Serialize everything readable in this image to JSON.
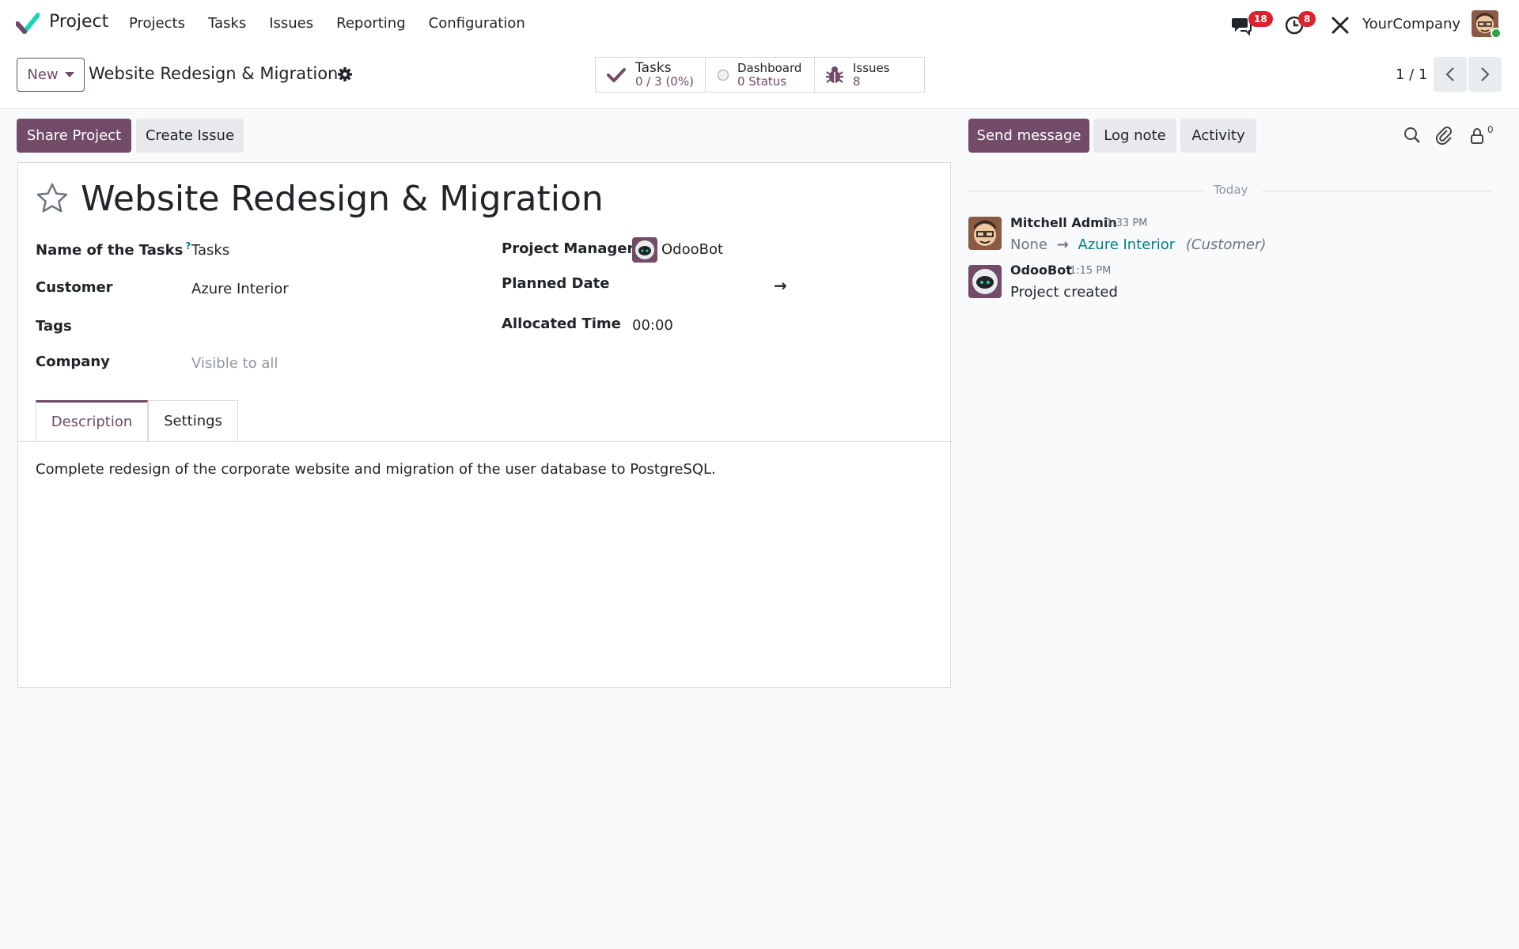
{
  "navbar": {
    "app_name": "Project",
    "menu": [
      "Projects",
      "Tasks",
      "Issues",
      "Reporting",
      "Configuration"
    ],
    "messages_badge": "18",
    "activities_badge": "8",
    "company": "YourCompany"
  },
  "control_panel": {
    "new_label": "New",
    "breadcrumb": "Website Redesign & Migration",
    "smart_buttons": {
      "tasks": {
        "label": "Tasks",
        "value": "0 / 3 (0%)"
      },
      "dashboard": {
        "label": "Dashboard",
        "value": "0 Status"
      },
      "issues": {
        "label": "Issues",
        "value": "8"
      }
    },
    "pager": "1 / 1"
  },
  "actions": {
    "share_project": "Share Project",
    "create_issue": "Create Issue",
    "send_message": "Send message",
    "log_note": "Log note",
    "activity": "Activity",
    "followers_count": "0"
  },
  "form": {
    "project_name": "Website Redesign & Migration",
    "fields": {
      "name_of_tasks": {
        "label": "Name of the Tasks",
        "value": "Tasks",
        "help": "?"
      },
      "customer": {
        "label": "Customer",
        "value": "Azure Interior"
      },
      "tags": {
        "label": "Tags",
        "value": ""
      },
      "company": {
        "label": "Company",
        "placeholder": "Visible to all"
      },
      "project_manager": {
        "label": "Project Manager",
        "value": "OdooBot"
      },
      "planned_date": {
        "label": "Planned Date",
        "arrow": "→"
      },
      "allocated_time": {
        "label": "Allocated Time",
        "value": "00:00"
      }
    },
    "tabs": [
      "Description",
      "Settings"
    ],
    "description": "Complete redesign of the corporate website and migration of the user database to PostgreSQL."
  },
  "chatter": {
    "date_separator": "Today",
    "messages": [
      {
        "author": "Mitchell Admin",
        "time": "1:33 PM",
        "old_value": "None",
        "arrow": "→",
        "new_value": "Azure Interior",
        "field": "(Customer)"
      },
      {
        "author": "OdooBot",
        "time": "1:15 PM",
        "body": "Project created"
      }
    ]
  },
  "colors": {
    "primary": "#714b67",
    "link": "#017e84",
    "badge": "#d9242f"
  }
}
